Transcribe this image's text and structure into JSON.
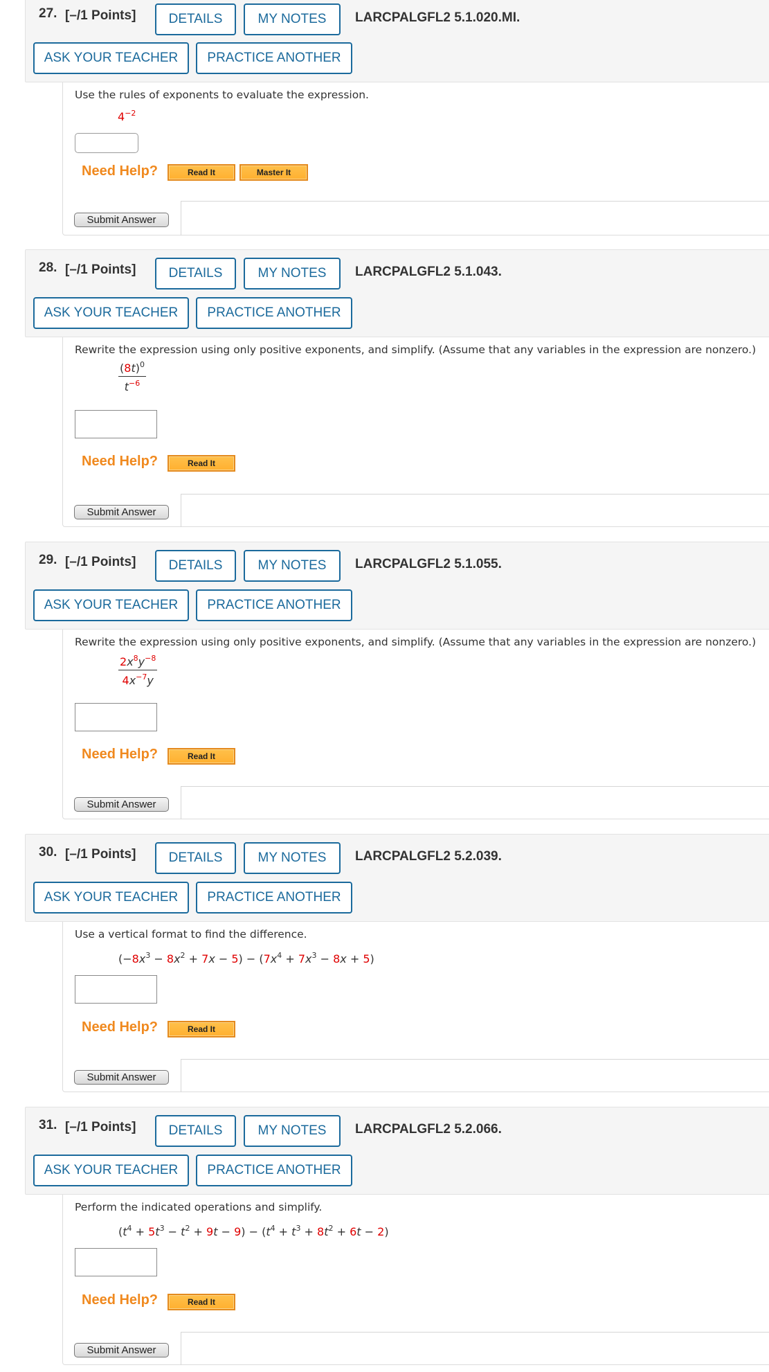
{
  "buttons": {
    "details": "DETAILS",
    "my_notes": "MY NOTES",
    "ask_teacher": "ASK YOUR TEACHER",
    "practice_another": "PRACTICE ANOTHER",
    "need_help": "Need Help?",
    "read_it": "Read It",
    "master_it": "Master It",
    "submit": "Submit Answer"
  },
  "problems": [
    {
      "number": "27.",
      "points": "[–/1 Points]",
      "code": "LARCPALGFL2 5.1.020.MI.",
      "prompt": "Use the rules of exponents to evaluate the expression.",
      "expression": {
        "base": "4",
        "exp": "−2"
      },
      "answer_value": "",
      "help": [
        "Read It",
        "Master It"
      ]
    },
    {
      "number": "28.",
      "points": "[–/1 Points]",
      "code": "LARCPALGFL2 5.1.043.",
      "prompt": "Rewrite the expression using only positive exponents, and simplify. (Assume that any variables in the expression are nonzero.)",
      "expression": {
        "num_open": "(",
        "num_coef": "8",
        "num_var": "t",
        "num_close": ")",
        "num_exp": "0",
        "den_var": "t",
        "den_exp": "−6"
      },
      "answer_value": "",
      "help": [
        "Read It"
      ]
    },
    {
      "number": "29.",
      "points": "[–/1 Points]",
      "code": "LARCPALGFL2 5.1.055.",
      "prompt": "Rewrite the expression using only positive exponents, and simplify. (Assume that any variables in the expression are nonzero.)",
      "expression": {
        "num_coef": "2",
        "num_x": "x",
        "num_x_exp": "8",
        "num_y": "y",
        "num_y_exp": "−8",
        "den_coef": "4",
        "den_x": "x",
        "den_x_exp": "−7",
        "den_y": "y"
      },
      "answer_value": "",
      "help": [
        "Read It"
      ]
    },
    {
      "number": "30.",
      "points": "[–/1 Points]",
      "code": "LARCPALGFL2 5.2.039.",
      "prompt": "Use a vertical format to find the difference.",
      "expression_text": "(−8x³ − 8x² + 7x − 5) − (7x⁴ + 7x³ − 8x + 5)",
      "answer_value": "",
      "help": [
        "Read It"
      ]
    },
    {
      "number": "31.",
      "points": "[–/1 Points]",
      "code": "LARCPALGFL2 5.2.066.",
      "prompt": "Perform the indicated operations and simplify.",
      "expression_text": "(t⁴ + 5t³ − t² + 9t − 9) − (t⁴ + t³ + 8t² + 6t − 2)",
      "answer_value": "",
      "help": [
        "Read It"
      ]
    }
  ],
  "colors": {
    "accent_blue": "#1b6a9c",
    "need_help_orange": "#f0891e",
    "coefficient_red": "#e00000",
    "header_bg": "#f5f5f5"
  }
}
